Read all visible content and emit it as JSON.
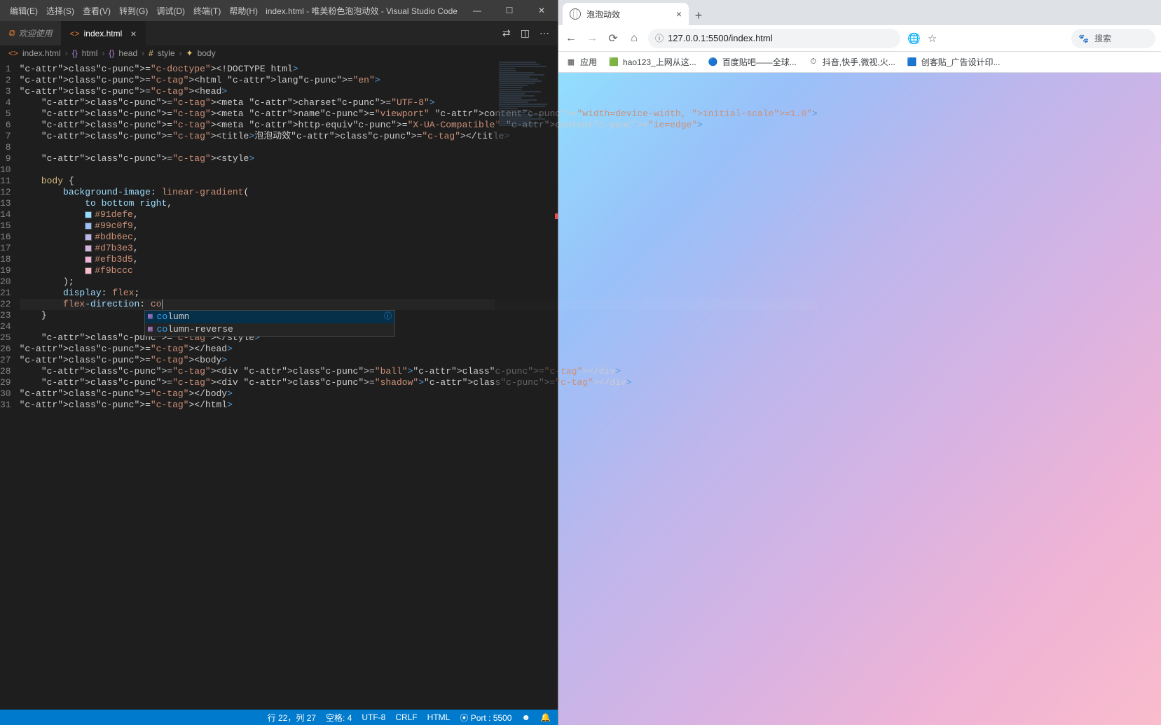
{
  "vsc": {
    "menu": [
      "编辑(E)",
      "选择(S)",
      "查看(V)",
      "转到(G)",
      "调试(D)",
      "终端(T)",
      "帮助(H)"
    ],
    "windowTitle": "index.html - 唯美粉色泡泡动效 - Visual Studio Code",
    "winbtn": {
      "min": "—",
      "max": "☐",
      "close": "✕"
    },
    "tab_welcome": "欢迎使用",
    "tab_active": "index.html",
    "breadcrumb": [
      "index.html",
      "html",
      "head",
      "style",
      "body"
    ],
    "lines": [
      "<!DOCTYPE html>",
      "<html lang=\"en\">",
      "<head>",
      "    <meta charset=\"UTF-8\">",
      "    <meta name=\"viewport\" content=\"width=device-width, initial-scale=1.0\">",
      "    <meta http-equiv=\"X-UA-Compatible\" content=\"ie=edge\">",
      "    <title>泡泡动效</title>",
      "",
      "    <style>",
      "",
      "    body {",
      "        background-image: linear-gradient(",
      "            to bottom right,",
      "            #91defe,",
      "            #99c0f9,",
      "            #bdb6ec,",
      "            #d7b3e3,",
      "            #efb3d5,",
      "            #f9bccc",
      "        );",
      "        display: flex;",
      "        flex-direction: co",
      "    }",
      "",
      "    </style>",
      "</head>",
      "<body>",
      "    <div class=\"ball\"></div>",
      "    <div class=\"shadow\"></div>",
      "</body>",
      "</html>"
    ],
    "colors": [
      "#91defe",
      "#99c0f9",
      "#bdb6ec",
      "#d7b3e3",
      "#efb3d5",
      "#f9bccc"
    ],
    "suggest": [
      {
        "match": "co",
        "rest": "lumn",
        "selected": true
      },
      {
        "match": "co",
        "rest": "lumn-reverse",
        "selected": false
      }
    ],
    "status": {
      "cursor": "行 22，列 27",
      "spaces": "空格: 4",
      "encoding": "UTF-8",
      "eol": "CRLF",
      "language": "HTML",
      "port": "Port : 5500"
    }
  },
  "browser": {
    "tabTitle": "泡泡动效",
    "url": "127.0.0.1:5500/index.html",
    "searchPlaceholder": "搜索",
    "apps": "应用",
    "bookmarks": [
      {
        "icon": "🟩",
        "label": "hao123_上网从这..."
      },
      {
        "icon": "🔵",
        "label": "百度贴吧——全球..."
      },
      {
        "icon": "⏱",
        "label": "抖音,快手,微视,火..."
      },
      {
        "icon": "🟦",
        "label": "创客贴_广告设计印..."
      }
    ]
  }
}
